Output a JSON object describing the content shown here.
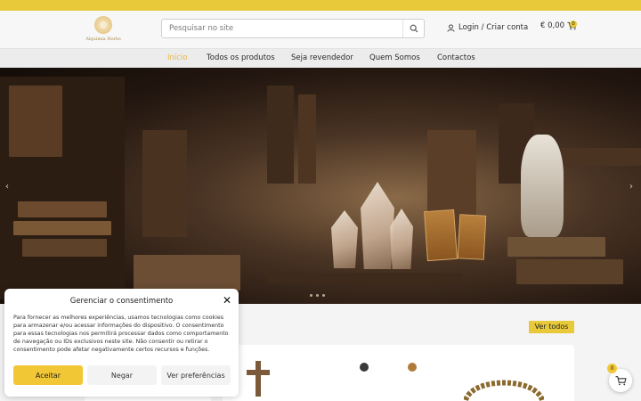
{
  "header": {
    "logo_text": "Alquimia Herbs",
    "search_placeholder": "Pesquisar no site",
    "login_label": "Login / Criar conta",
    "cart_total": "€ 0,00",
    "cart_count": "0"
  },
  "nav": {
    "items": [
      {
        "label": "Início",
        "active": true
      },
      {
        "label": "Todos os produtos",
        "active": false
      },
      {
        "label": "Seja revendedor",
        "active": false
      },
      {
        "label": "Quem Somos",
        "active": false
      },
      {
        "label": "Contactos",
        "active": false
      }
    ]
  },
  "hero": {
    "prev_glyph": "‹",
    "next_glyph": "›",
    "slide_count": 3,
    "active_slide": 1
  },
  "section": {
    "view_all_label": "Ver todos"
  },
  "consent": {
    "title": "Gerenciar o consentimento",
    "close_glyph": "✕",
    "text": "Para fornecer as melhores experiências, usamos tecnologias como cookies para armazenar e/ou acessar informações do dispositivo. O consentimento para essas tecnologias nos permitirá processar dados como comportamento de navegação ou IDs exclusivos neste site. Não consentir ou retirar o consentimento pode afetar negativamente certos recursos e funções.",
    "accept_label": "Aceitar",
    "deny_label": "Negar",
    "prefs_label": "Ver preferências"
  },
  "floating_cart": {
    "count": "0"
  },
  "colors": {
    "accent": "#e8c93a",
    "nav_active": "#e6b84a"
  },
  "icons": {
    "search": "search-icon",
    "user": "user-icon",
    "cart": "cart-icon",
    "close": "close-icon"
  }
}
